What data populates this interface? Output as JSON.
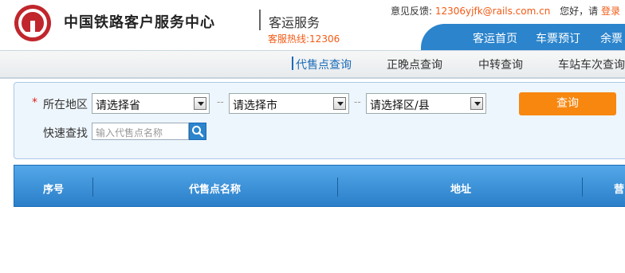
{
  "header": {
    "brand": "中国铁路客户服务中心",
    "subtitle": "客运服务",
    "hotline": "客服热线:12306",
    "feedback_label": "意见反馈:",
    "feedback_email": "12306yjfk@rails.com.cn",
    "greeting": "您好，请",
    "login": "登录"
  },
  "nav": {
    "items": [
      "客运首页",
      "车票预订",
      "余票"
    ]
  },
  "subnav": {
    "items": [
      "代售点查询",
      "正晚点查询",
      "中转查询",
      "车站车次查询"
    ],
    "active": 0
  },
  "query": {
    "required_mark": "*",
    "region_label": "所在地区",
    "province": "请选择省",
    "city": "请选择市",
    "district": "请选择区/县",
    "separator": "--",
    "query_button": "查询",
    "quick_label": "快速查找",
    "search_placeholder": "输入代售点名称"
  },
  "table": {
    "columns": [
      "序号",
      "代售点名称",
      "地址",
      "营"
    ]
  },
  "colors": {
    "brand_blue": "#2b84cc",
    "orange": "#f7870f",
    "hotline": "#f25a15"
  }
}
